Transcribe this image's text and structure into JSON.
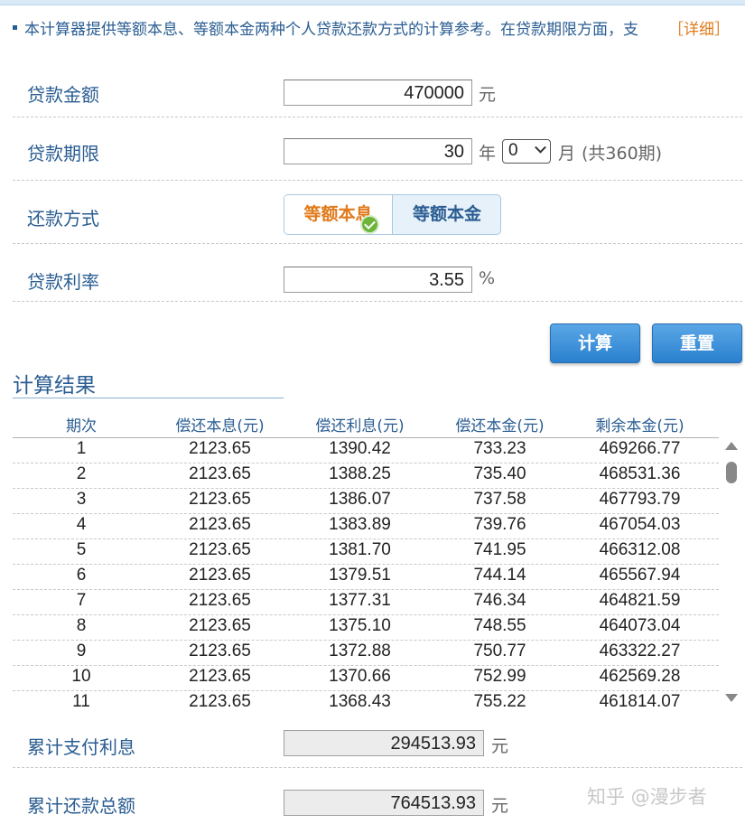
{
  "notice": {
    "text": "本计算器提供等额本息、等额本金两种个人贷款还款方式的计算参考。在贷款期限方面，支",
    "detail_link": "［详细］"
  },
  "form": {
    "amount": {
      "label": "贷款金额",
      "value": "470000",
      "unit": "元"
    },
    "term": {
      "label": "贷款期限",
      "years": "30",
      "year_unit": "年",
      "months_selected": "0",
      "month_unit": "月",
      "total": "(共360期)"
    },
    "method": {
      "label": "还款方式",
      "options": [
        "等额本息",
        "等额本金"
      ],
      "selected": "等额本息"
    },
    "rate": {
      "label": "贷款利率",
      "value": "3.55",
      "unit": "%"
    }
  },
  "buttons": {
    "calculate": "计算",
    "reset": "重置"
  },
  "results": {
    "title": "计算结果",
    "columns": [
      "期次",
      "偿还本息(元)",
      "偿还利息(元)",
      "偿还本金(元)",
      "剩余本金(元)"
    ],
    "rows": [
      [
        "1",
        "2123.65",
        "1390.42",
        "733.23",
        "469266.77"
      ],
      [
        "2",
        "2123.65",
        "1388.25",
        "735.40",
        "468531.36"
      ],
      [
        "3",
        "2123.65",
        "1386.07",
        "737.58",
        "467793.79"
      ],
      [
        "4",
        "2123.65",
        "1383.89",
        "739.76",
        "467054.03"
      ],
      [
        "5",
        "2123.65",
        "1381.70",
        "741.95",
        "466312.08"
      ],
      [
        "6",
        "2123.65",
        "1379.51",
        "744.14",
        "465567.94"
      ],
      [
        "7",
        "2123.65",
        "1377.31",
        "746.34",
        "464821.59"
      ],
      [
        "8",
        "2123.65",
        "1375.10",
        "748.55",
        "464073.04"
      ],
      [
        "9",
        "2123.65",
        "1372.88",
        "750.77",
        "463322.27"
      ],
      [
        "10",
        "2123.65",
        "1370.66",
        "752.99",
        "462569.28"
      ],
      [
        "11",
        "2123.65",
        "1368.43",
        "755.22",
        "461814.07"
      ]
    ]
  },
  "summary": {
    "total_interest": {
      "label": "累计支付利息",
      "value": "294513.93",
      "unit": "元"
    },
    "total_payment": {
      "label": "累计还款总额",
      "value": "764513.93",
      "unit": "元"
    }
  },
  "watermark": "知乎 @漫步者",
  "colors": {
    "label_blue": "#2a5d92",
    "accent_orange": "#e07a1a",
    "button_blue": "#2a80cf"
  }
}
